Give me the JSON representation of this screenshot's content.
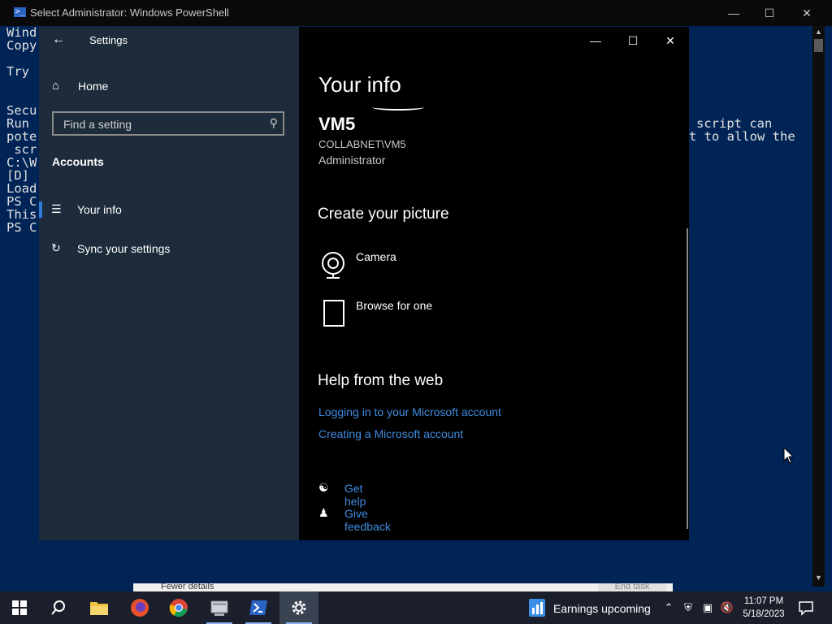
{
  "powershell": {
    "title": "Select Administrator: Windows PowerShell",
    "lines": [
      "Wind",
      "Copy",
      "",
      "Try",
      "",
      "Secu",
      "Run",
      "pote",
      " scr",
      "C:\\W",
      "[D]",
      "Load",
      "PS C",
      "This",
      "PS C"
    ],
    "right_line_1": "script can",
    "right_line_2": "t to allow the"
  },
  "behind_dialog": {
    "fewer_details": "Fewer details",
    "end_task": "End task"
  },
  "settings": {
    "title": "Settings",
    "home": "Home",
    "search_placeholder": "Find a setting",
    "section": "Accounts",
    "nav_items": [
      {
        "label": "Your info",
        "icon": "contact-card-icon",
        "active": true
      },
      {
        "label": "Sync your settings",
        "icon": "sync-icon",
        "active": false
      }
    ]
  },
  "content": {
    "heading": "Your info",
    "user_name": "VM5",
    "user_domain": "COLLABNET\\VM5",
    "user_role": "Administrator",
    "create_picture_heading": "Create your picture",
    "options": [
      {
        "label": "Camera",
        "icon": "camera-icon"
      },
      {
        "label": "Browse for one",
        "icon": "file-icon"
      }
    ],
    "help_heading": "Help from the web",
    "links": [
      "Logging in to your Microsoft account",
      "Creating a Microsoft account"
    ],
    "get_help": "Get help",
    "give_feedback": "Give feedback"
  },
  "taskbar": {
    "news_label": "Earnings upcoming",
    "time": "11:07 PM",
    "date": "5/18/2023"
  },
  "colors": {
    "powershell_bg": "#012456",
    "settings_nav_bg": "#1d2b3a",
    "link": "#3f8ce0",
    "taskbar_bg": "#1a1f2b"
  }
}
